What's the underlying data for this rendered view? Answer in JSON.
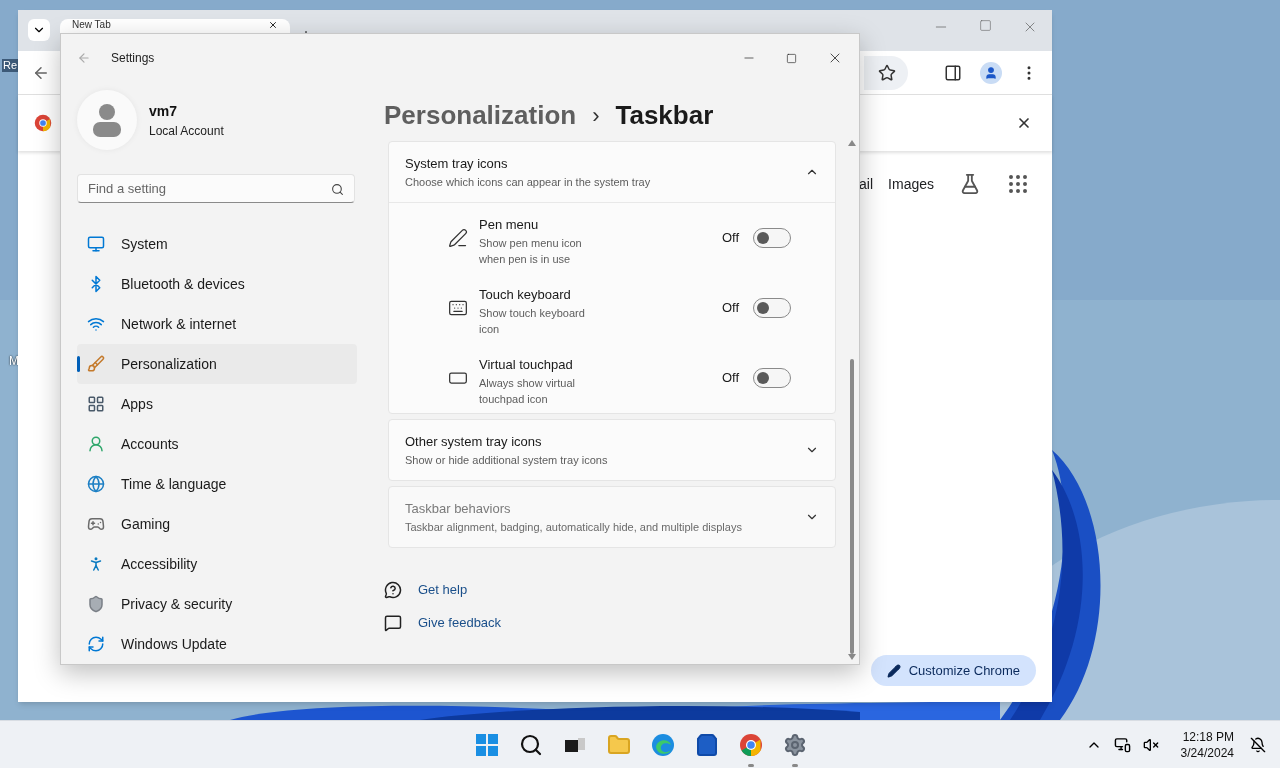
{
  "desktop": {
    "icon_labels": [
      "Re",
      "M"
    ]
  },
  "browser": {
    "tab": {
      "title": "New Tab"
    },
    "links": [
      "ail",
      "Images"
    ],
    "customize_button": "Customize Chrome"
  },
  "settings": {
    "title": "Settings",
    "account": {
      "name": "vm7",
      "type": "Local Account"
    },
    "search": {
      "placeholder": "Find a setting"
    },
    "nav": [
      {
        "label": "System",
        "kind": "system",
        "selected": false
      },
      {
        "label": "Bluetooth & devices",
        "kind": "bluetooth",
        "selected": false
      },
      {
        "label": "Network & internet",
        "kind": "network",
        "selected": false
      },
      {
        "label": "Personalization",
        "kind": "personalization",
        "selected": true
      },
      {
        "label": "Apps",
        "kind": "apps",
        "selected": false
      },
      {
        "label": "Accounts",
        "kind": "accounts",
        "selected": false
      },
      {
        "label": "Time & language",
        "kind": "time",
        "selected": false
      },
      {
        "label": "Gaming",
        "kind": "gaming",
        "selected": false
      },
      {
        "label": "Accessibility",
        "kind": "accessibility",
        "selected": false
      },
      {
        "label": "Privacy & security",
        "kind": "privacy",
        "selected": false
      },
      {
        "label": "Windows Update",
        "kind": "update",
        "selected": false
      }
    ],
    "breadcrumb": {
      "parent": "Personalization",
      "separator": "›",
      "current": "Taskbar"
    },
    "sections": [
      {
        "title": "System tray icons",
        "subtitle": "Choose which icons can appear in the system tray",
        "expanded": true,
        "disabled": false,
        "items": [
          {
            "kind": "pen",
            "label": "Pen menu",
            "description": "Show pen menu icon when pen is in use",
            "state_text": "Off",
            "on": false
          },
          {
            "kind": "keyboard",
            "label": "Touch keyboard",
            "description": "Show touch keyboard icon",
            "state_text": "Off",
            "on": false
          },
          {
            "kind": "touchpad",
            "label": "Virtual touchpad",
            "description": "Always show virtual touchpad icon",
            "state_text": "Off",
            "on": false
          }
        ]
      },
      {
        "title": "Other system tray icons",
        "subtitle": "Show or hide additional system tray icons",
        "expanded": false,
        "disabled": false
      },
      {
        "title": "Taskbar behaviors",
        "subtitle": "Taskbar alignment, badging, automatically hide, and multiple displays",
        "expanded": false,
        "disabled": true
      }
    ],
    "links": [
      {
        "kind": "help",
        "label": "Get help"
      },
      {
        "kind": "feedback",
        "label": "Give feedback"
      }
    ]
  },
  "taskbar": {
    "apps": [
      {
        "kind": "start",
        "running": false
      },
      {
        "kind": "search",
        "running": false
      },
      {
        "kind": "taskview",
        "running": false
      },
      {
        "kind": "explorer",
        "running": false
      },
      {
        "kind": "edge",
        "running": false
      },
      {
        "kind": "store",
        "running": false
      },
      {
        "kind": "chrome",
        "running": true
      },
      {
        "kind": "settings",
        "running": true
      }
    ],
    "time": "12:18 PM",
    "date": "3/24/2024"
  }
}
